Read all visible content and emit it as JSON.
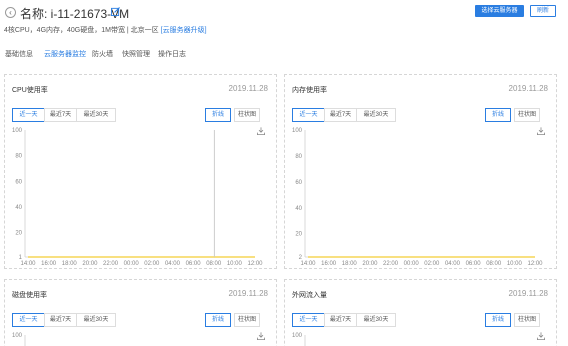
{
  "header": {
    "back_icon": "chevron-left-icon",
    "name_label": "名称: i-11-21673-VM",
    "edit_icon": "edit-icon",
    "spec_text": "4核CPU，4G内存，40G硬盘，1M带宽 | 北京一区 ",
    "upgrade_link": "[云服务器升级]",
    "primary_button": "选择云服务器",
    "refresh_button": "刷新"
  },
  "tabs": [
    {
      "label": "基础信息",
      "active": false
    },
    {
      "label": "云服务器监控",
      "active": true
    },
    {
      "label": "防火墙",
      "active": false
    },
    {
      "label": "快照管理",
      "active": false
    },
    {
      "label": "操作日志",
      "active": false
    }
  ],
  "panels": [
    {
      "title": "CPU使用率",
      "date": "2019.11.28",
      "ranges": [
        "近一天",
        "最近7天",
        "最近30天"
      ],
      "active_range": 0,
      "chart_types": [
        "折线",
        "柱状图"
      ],
      "active_type": 0,
      "download_icon": "download-icon"
    },
    {
      "title": "内存使用率",
      "date": "2019.11.28",
      "ranges": [
        "近一天",
        "最近7天",
        "最近30天"
      ],
      "active_range": 0,
      "chart_types": [
        "折线",
        "柱状图"
      ],
      "active_type": 0,
      "download_icon": "download-icon"
    },
    {
      "title": "磁盘使用率",
      "date": "2019.11.28",
      "ranges": [
        "近一天",
        "最近7天",
        "最近30天"
      ],
      "active_range": 0,
      "chart_types": [
        "折线",
        "柱状图"
      ],
      "active_type": 0,
      "download_icon": "download-icon"
    },
    {
      "title": "外网流入量",
      "date": "2019.11.28",
      "ranges": [
        "近一天",
        "最近7天",
        "最近30天"
      ],
      "active_range": 0,
      "chart_types": [
        "折线",
        "柱状图"
      ],
      "active_type": 0,
      "download_icon": "download-icon"
    }
  ],
  "colors": {
    "accent": "#2a7de1",
    "line": "#f2c100",
    "border": "#d6d6d6"
  },
  "chart_data": [
    {
      "type": "line",
      "title": "CPU使用率",
      "x": [
        "14:00",
        "16:00",
        "18:00",
        "20:00",
        "22:00",
        "00:00",
        "02:00",
        "04:00",
        "06:00",
        "08:00",
        "10:00",
        "12:00"
      ],
      "y_ticks": [
        1,
        20,
        40,
        60,
        80,
        100
      ],
      "ylim": [
        1,
        100
      ],
      "series": [
        {
          "values": [
            1,
            1,
            1,
            1,
            1,
            1,
            1,
            1,
            1,
            1,
            100,
            1
          ]
        }
      ]
    },
    {
      "type": "line",
      "title": "内存使用率",
      "x": [
        "14:00",
        "16:00",
        "18:00",
        "20:00",
        "22:00",
        "00:00",
        "02:00",
        "04:00",
        "06:00",
        "08:00",
        "10:00",
        "12:00"
      ],
      "y_ticks": [
        2,
        20,
        40,
        60,
        80,
        100
      ],
      "ylim": [
        2,
        100
      ],
      "series": [
        {
          "values": [
            2,
            2,
            2,
            2,
            2,
            2,
            2,
            2,
            2,
            2,
            2,
            2
          ]
        }
      ]
    },
    {
      "type": "line",
      "title": "磁盘使用率",
      "x": [],
      "y_ticks": [
        100
      ],
      "ylim": [
        0,
        100
      ],
      "series": []
    },
    {
      "type": "line",
      "title": "外网流入量",
      "x": [],
      "y_ticks": [
        100
      ],
      "ylim": [
        0,
        100
      ],
      "series": []
    }
  ]
}
